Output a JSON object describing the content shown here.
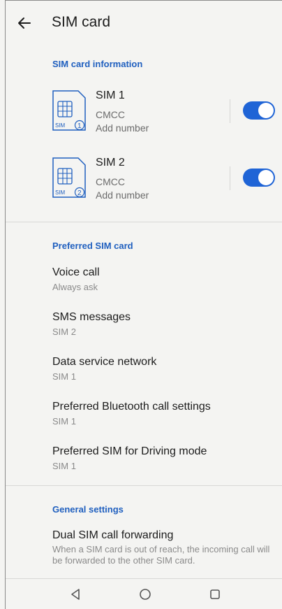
{
  "header": {
    "title": "SIM card"
  },
  "sim_info": {
    "header": "SIM card information",
    "sims": [
      {
        "name": "SIM 1",
        "carrier": "CMCC",
        "number": "Add number",
        "badge_label": "SIM",
        "badge_number": "1",
        "enabled": true
      },
      {
        "name": "SIM 2",
        "carrier": "CMCC",
        "number": "Add number",
        "badge_label": "SIM",
        "badge_number": "2",
        "enabled": true
      }
    ]
  },
  "preferred": {
    "header": "Preferred SIM card",
    "items": [
      {
        "title": "Voice call",
        "subtitle": "Always ask"
      },
      {
        "title": "SMS messages",
        "subtitle": "SIM 2"
      },
      {
        "title": "Data service network",
        "subtitle": "SIM 1"
      },
      {
        "title": "Preferred Bluetooth call settings",
        "subtitle": "SIM 1"
      },
      {
        "title": "Preferred SIM for Driving mode",
        "subtitle": "SIM 1"
      }
    ]
  },
  "general": {
    "header": "General settings",
    "items": [
      {
        "title": "Dual SIM call forwarding",
        "description": "When a SIM card is out of reach, the incoming call will be forwarded to the other SIM card."
      }
    ]
  },
  "colors": {
    "accent": "#1f64d6",
    "section_header": "#1f5fbf",
    "background": "#f4f4f2"
  },
  "icons": {
    "back": "arrow-left-icon",
    "sim": "sim-card-icon",
    "nav_back": "triangle-back-icon",
    "nav_home": "circle-home-icon",
    "nav_recents": "square-recents-icon"
  }
}
